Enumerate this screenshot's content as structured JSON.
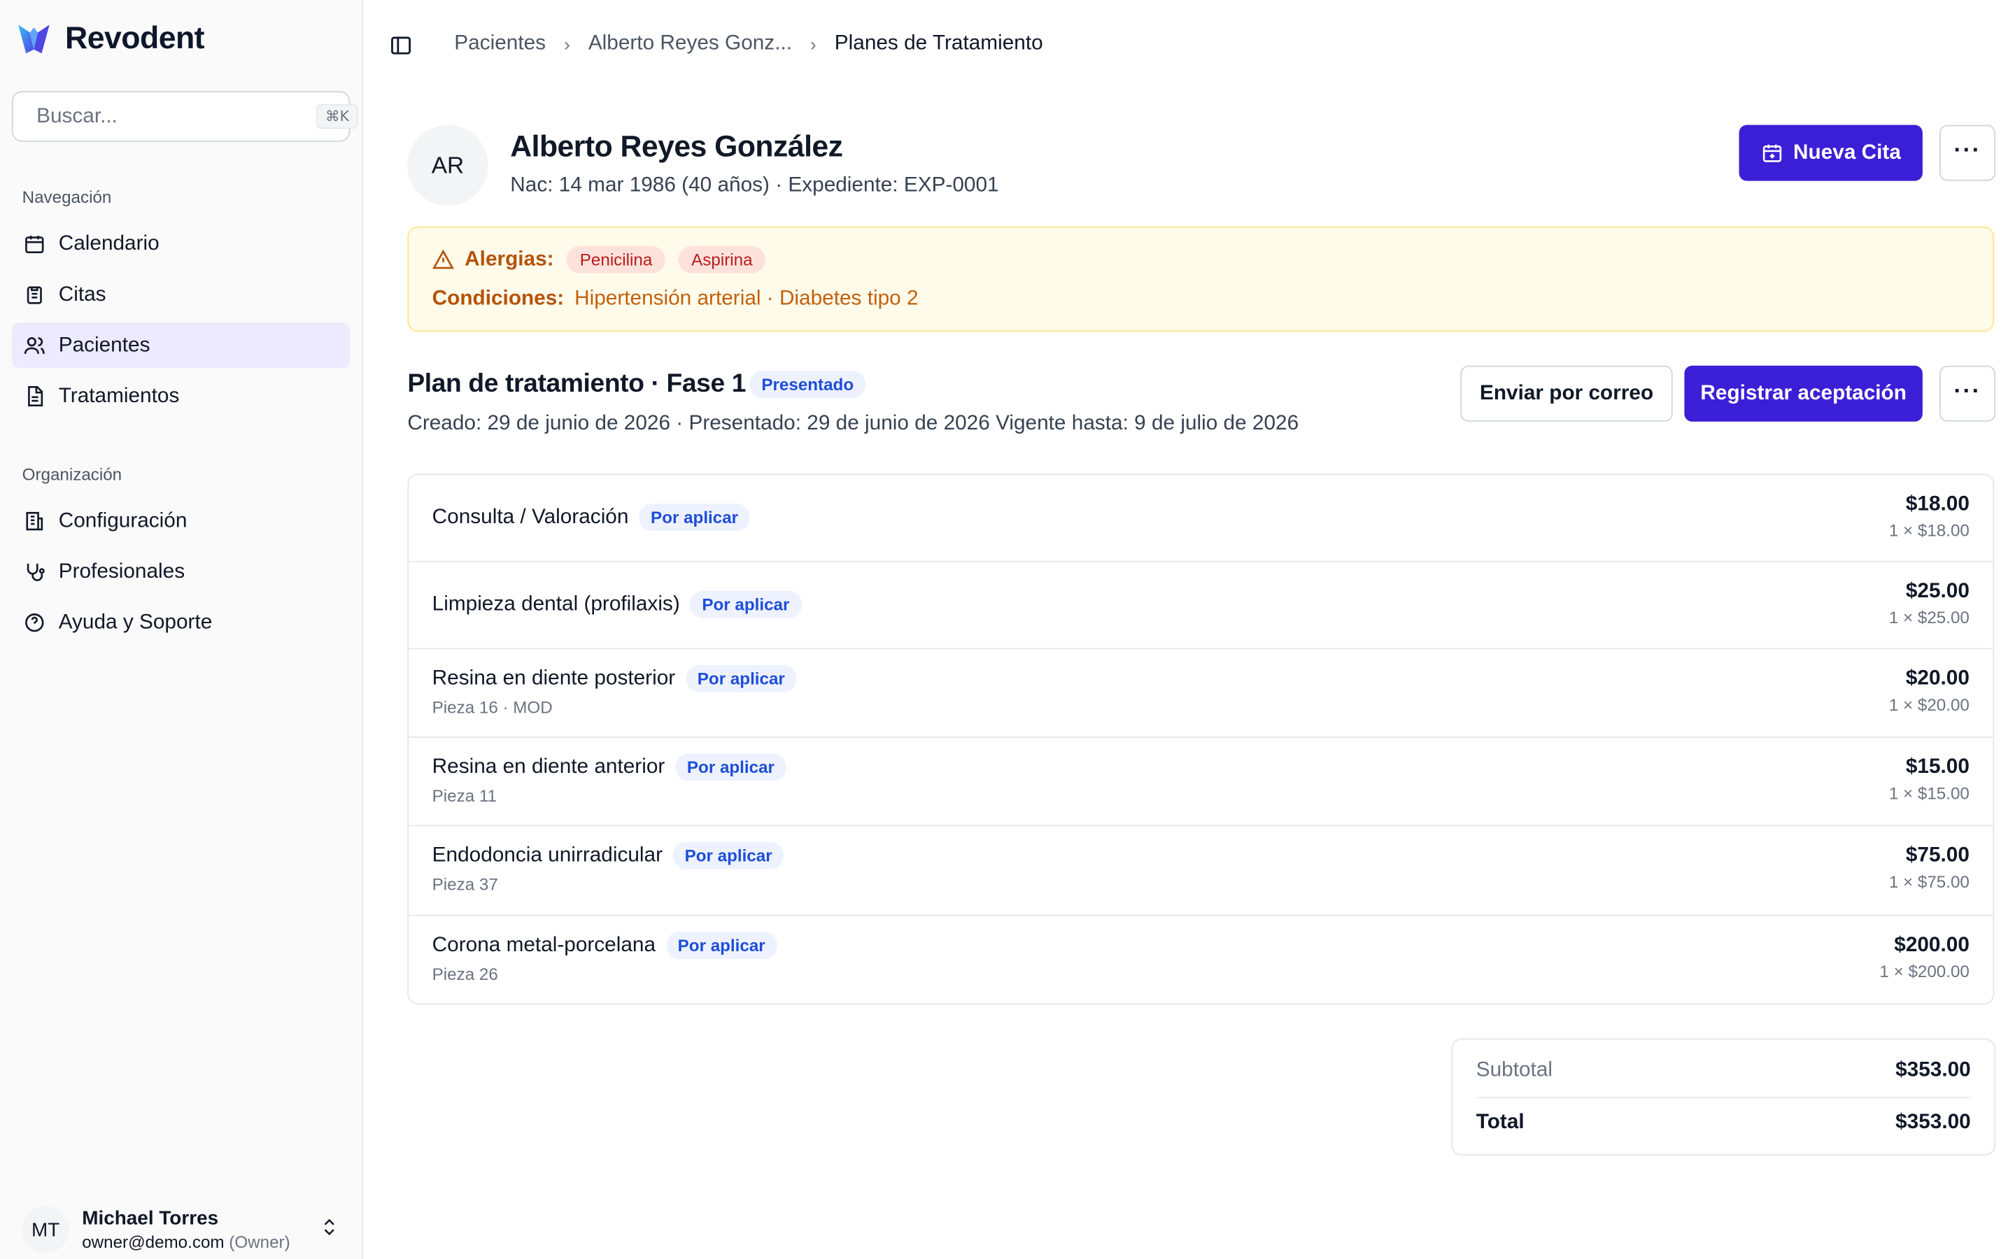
{
  "app": {
    "brand": "Revodent",
    "brand_color": "#3b82f6",
    "accent": "#3b1fd6"
  },
  "search": {
    "placeholder": "Buscar...",
    "shortcut": "⌘K"
  },
  "sidebar": {
    "nav_label": "Navegación",
    "nav": [
      {
        "label": "Calendario",
        "icon": "calendar-icon"
      },
      {
        "label": "Citas",
        "icon": "clipboard-icon"
      },
      {
        "label": "Pacientes",
        "icon": "users-icon",
        "active": true
      },
      {
        "label": "Tratamientos",
        "icon": "file-text-icon"
      }
    ],
    "org_label": "Organización",
    "org": [
      {
        "label": "Configuración",
        "icon": "building-icon"
      },
      {
        "label": "Profesionales",
        "icon": "stethoscope-icon"
      },
      {
        "label": "Ayuda y Soporte",
        "icon": "help-circle-icon"
      }
    ]
  },
  "user": {
    "initials": "MT",
    "name": "Michael Torres",
    "email": "owner@demo.com",
    "role": "(Owner)"
  },
  "breadcrumb": {
    "items": [
      "Pacientes",
      "Alberto Reyes Gonz...",
      "Planes de Tratamiento"
    ]
  },
  "patient": {
    "initials": "AR",
    "name": "Alberto Reyes González",
    "meta": "Nac: 14 mar 1986 (40 años) · Expediente: EXP-0001",
    "new_appointment": "Nueva Cita",
    "more": "···"
  },
  "alerts": {
    "allergies_label": "Alergias:",
    "allergies": [
      "Penicilina",
      "Aspirina"
    ],
    "conditions_label": "Condiciones:",
    "conditions": "Hipertensión arterial · Diabetes tipo 2"
  },
  "plan": {
    "title": "Plan de tratamiento · Fase 1",
    "status": "Presentado",
    "dates": "Creado: 29 de junio de 2026 · Presentado: 29 de junio de 2026  Vigente hasta: 9 de julio de 2026",
    "send_email": "Enviar por correo",
    "register": "Registrar aceptación",
    "more": "···"
  },
  "items": [
    {
      "name": "Consulta / Valoración",
      "status": "Por aplicar",
      "sub": "",
      "price": "$18.00",
      "qty": "1 × $18.00"
    },
    {
      "name": "Limpieza dental (profilaxis)",
      "status": "Por aplicar",
      "sub": "",
      "price": "$25.00",
      "qty": "1 × $25.00"
    },
    {
      "name": "Resina en diente posterior",
      "status": "Por aplicar",
      "sub": "Pieza 16 · MOD",
      "price": "$20.00",
      "qty": "1 × $20.00"
    },
    {
      "name": "Resina en diente anterior",
      "status": "Por aplicar",
      "sub": "Pieza 11",
      "price": "$15.00",
      "qty": "1 × $15.00"
    },
    {
      "name": "Endodoncia unirradicular",
      "status": "Por aplicar",
      "sub": "Pieza 37",
      "price": "$75.00",
      "qty": "1 × $75.00"
    },
    {
      "name": "Corona metal-porcelana",
      "status": "Por aplicar",
      "sub": "Pieza 26",
      "price": "$200.00",
      "qty": "1 × $200.00"
    }
  ],
  "totals": {
    "subtotal_label": "Subtotal",
    "subtotal": "$353.00",
    "total_label": "Total",
    "total": "$353.00"
  }
}
